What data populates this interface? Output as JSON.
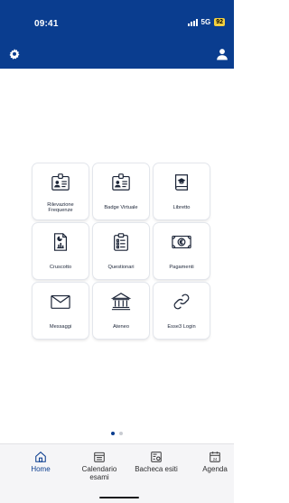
{
  "status_bar": {
    "time": "09:41",
    "network": "5G",
    "battery": "92"
  },
  "colors": {
    "header": "#0a3d8f",
    "accent": "#0a3d8f",
    "battery": "#f4d03f"
  },
  "header": {
    "left_icon": "gear-icon",
    "right_icon": "user-icon"
  },
  "grid": {
    "tiles": [
      {
        "label": "Rilevazione Frequenze",
        "icon": "attendance-badge-icon"
      },
      {
        "label": "Badge Virtuale",
        "icon": "id-badge-icon"
      },
      {
        "label": "Libretto",
        "icon": "booklet-icon"
      },
      {
        "label": "Cruscotto",
        "icon": "dashboard-report-icon"
      },
      {
        "label": "Questionari",
        "icon": "clipboard-icon"
      },
      {
        "label": "Pagamenti",
        "icon": "euro-banknote-icon"
      },
      {
        "label": "Messaggi",
        "icon": "envelope-icon"
      },
      {
        "label": "Ateneo",
        "icon": "university-building-icon"
      },
      {
        "label": "Esse3 Login",
        "icon": "link-icon"
      }
    ]
  },
  "pager": {
    "current_page": 1,
    "page_count": 2
  },
  "tabbar": {
    "items": [
      {
        "label": "Home",
        "icon": "home-icon",
        "active": true
      },
      {
        "label": "Calendario\nesami",
        "icon": "calendar-icon",
        "active": false
      },
      {
        "label": "Bacheca esiti",
        "icon": "results-board-icon",
        "active": false
      },
      {
        "label": "Agenda",
        "icon": "agenda-calendar-icon",
        "active": false
      }
    ]
  }
}
